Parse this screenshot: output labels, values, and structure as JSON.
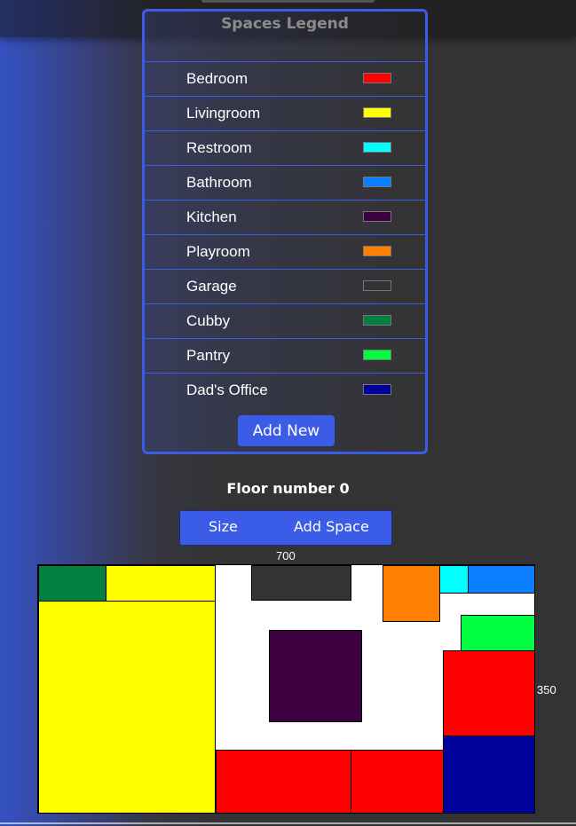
{
  "legend": {
    "title": "Spaces Legend",
    "items": [
      {
        "label": "Bedroom",
        "color": "#ff0000"
      },
      {
        "label": "Livingroom",
        "color": "#ffff00"
      },
      {
        "label": "Restroom",
        "color": "#00ffff"
      },
      {
        "label": "Bathroom",
        "color": "#0a7fff"
      },
      {
        "label": "Kitchen",
        "color": "#3d0040"
      },
      {
        "label": "Playroom",
        "color": "#ff8000"
      },
      {
        "label": "Garage",
        "color": "#333333"
      },
      {
        "label": "Cubby",
        "color": "#038040"
      },
      {
        "label": "Pantry",
        "color": "#00ff40"
      },
      {
        "label": "Dad's Office",
        "color": "#00009a"
      }
    ],
    "add_new_label": "Add New"
  },
  "floor": {
    "title": "Floor number 0",
    "size_button": "Size",
    "add_space_button": "Add Space",
    "width_label": "700",
    "height_label": "350",
    "background_color": "#ffffff"
  }
}
